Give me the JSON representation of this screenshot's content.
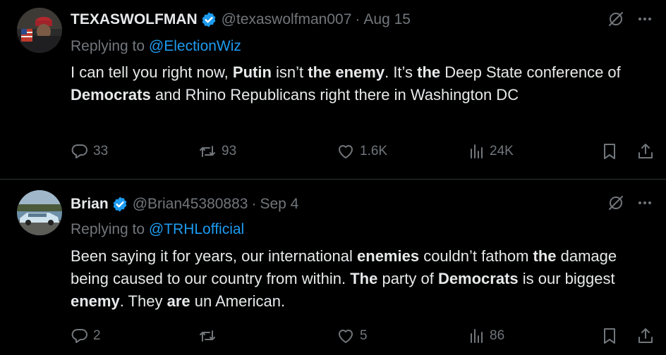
{
  "colors": {
    "background": "#000000",
    "text": "#e7e9ea",
    "muted": "#71767b",
    "link": "#1d9bf0",
    "verified": "#1d9bf0",
    "divider": "#2f3336"
  },
  "tweets": [
    {
      "name": "TEXASWOLFMAN",
      "handle": "@texaswolfman007",
      "separator": "·",
      "date": "Aug 15",
      "verified": true,
      "reply_prefix": "Replying to ",
      "reply_to": "@ElectionWiz",
      "body": [
        {
          "t": "I can tell you right now, ",
          "b": false
        },
        {
          "t": "Putin",
          "b": true
        },
        {
          "t": " isn’t ",
          "b": false
        },
        {
          "t": "the enemy",
          "b": true
        },
        {
          "t": ". It’s ",
          "b": false
        },
        {
          "t": "the",
          "b": true
        },
        {
          "t": " Deep State conference of ",
          "b": false
        },
        {
          "t": "Democrats",
          "b": true
        },
        {
          "t": " and Rhino Republicans right there in Washington DC",
          "b": false
        }
      ],
      "stats": {
        "replies": "33",
        "reposts": "93",
        "likes": "1.6K",
        "views": "24K"
      },
      "icons": {
        "grok": "slashed-circle-icon",
        "more": "more-dots-icon",
        "reply": "reply-icon",
        "repost": "repost-icon",
        "like": "heart-icon",
        "views": "views-icon",
        "bookmark": "bookmark-icon",
        "share": "share-icon"
      }
    },
    {
      "name": "Brian",
      "handle": "@Brian45380883",
      "separator": "·",
      "date": "Sep 4",
      "verified": true,
      "reply_prefix": "Replying to ",
      "reply_to": "@TRHLofficial",
      "body": [
        {
          "t": "Been saying it for years, our international ",
          "b": false
        },
        {
          "t": "enemies",
          "b": true
        },
        {
          "t": " couldn’t fathom ",
          "b": false
        },
        {
          "t": "the",
          "b": true
        },
        {
          "t": " damage being caused to our country from within.  ",
          "b": false
        },
        {
          "t": "The",
          "b": true
        },
        {
          "t": " party of ",
          "b": false
        },
        {
          "t": "Democrats",
          "b": true
        },
        {
          "t": " is our biggest ",
          "b": false
        },
        {
          "t": "enemy",
          "b": true
        },
        {
          "t": ".  They ",
          "b": false
        },
        {
          "t": "are",
          "b": true
        },
        {
          "t": " un American.",
          "b": false
        }
      ],
      "stats": {
        "replies": "2",
        "reposts": "",
        "likes": "5",
        "views": "86"
      },
      "icons": {
        "grok": "slashed-circle-icon",
        "more": "more-dots-icon",
        "reply": "reply-icon",
        "repost": "repost-icon",
        "like": "heart-icon",
        "views": "views-icon",
        "bookmark": "bookmark-icon",
        "share": "share-icon"
      }
    }
  ]
}
